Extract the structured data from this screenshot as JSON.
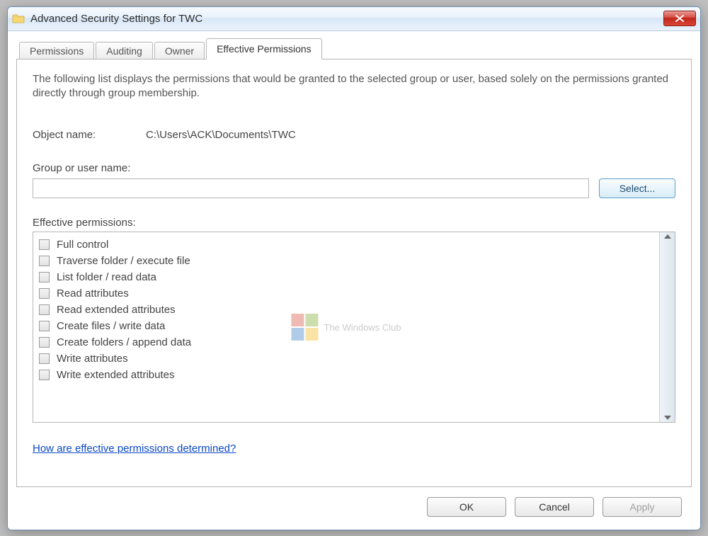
{
  "window": {
    "title": "Advanced Security Settings for TWC"
  },
  "tabs": [
    {
      "label": "Permissions"
    },
    {
      "label": "Auditing"
    },
    {
      "label": "Owner"
    },
    {
      "label": "Effective Permissions"
    }
  ],
  "active_tab_index": 3,
  "panel": {
    "description": "The following list displays the permissions that would be granted to the selected group or user, based solely on the permissions granted directly through group membership.",
    "object_name_label": "Object name:",
    "object_name_value": "C:\\Users\\ACK\\Documents\\TWC",
    "group_user_label": "Group or user name:",
    "group_user_value": "",
    "select_button": "Select...",
    "effective_permissions_label": "Effective permissions:",
    "permissions": [
      "Full control",
      "Traverse folder / execute file",
      "List folder / read data",
      "Read attributes",
      "Read extended attributes",
      "Create files / write data",
      "Create folders / append data",
      "Write attributes",
      "Write extended attributes"
    ],
    "help_link": "How are effective permissions determined?"
  },
  "watermark": {
    "text": "The Windows Club",
    "colors": [
      "#d33a2c",
      "#6ea21b",
      "#1f6fbf",
      "#f3b300"
    ]
  },
  "buttons": {
    "ok": "OK",
    "cancel": "Cancel",
    "apply": "Apply"
  }
}
